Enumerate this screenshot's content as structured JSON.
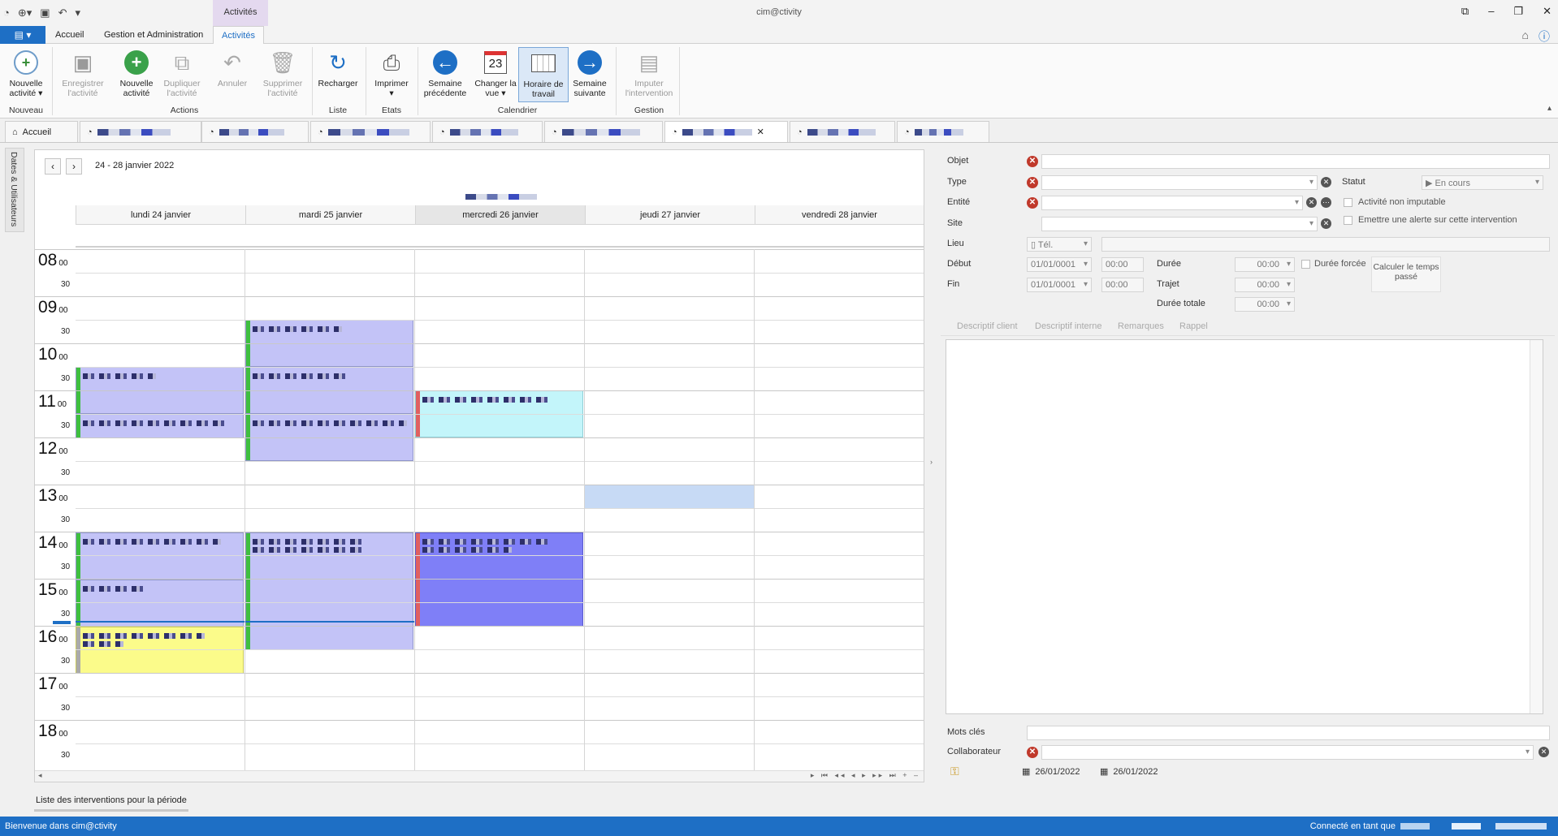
{
  "window": {
    "title": "cim@ctivity",
    "context_tab_header": "Activités"
  },
  "ribbon_tabs": [
    {
      "label": "Accueil"
    },
    {
      "label": "Gestion et Administration"
    },
    {
      "label": "Activités"
    }
  ],
  "ribbon": {
    "buttons": {
      "nouvelle_activite_menu": "Nouvelle activité",
      "enregistrer": "Enregistrer l'activité",
      "nouvelle_activite": "Nouvelle activité",
      "dupliquer": "Dupliquer l'activité",
      "annuler": "Annuler",
      "supprimer": "Supprimer l'activité",
      "recharger": "Recharger",
      "imprimer": "Imprimer",
      "semaine_precedente": "Semaine précédente",
      "changer_vue": "Changer la vue",
      "horaire_travail": "Horaire de travail",
      "semaine_suivante": "Semaine suivante",
      "imputer": "Imputer l'intervention"
    },
    "groups": {
      "nouveau": "Nouveau",
      "actions": "Actions",
      "liste": "Liste",
      "etats": "Etats",
      "calendrier": "Calendrier",
      "gestion": "Gestion"
    },
    "calendar_icon_day": "23"
  },
  "doc_tabs": [
    {
      "label": "Accueil"
    }
  ],
  "side_tab": "Dates & Utilisateurs",
  "calendar": {
    "range": "24 - 28 janvier 2022",
    "days": [
      {
        "label": "lundi 24 janvier"
      },
      {
        "label": "mardi 25 janvier"
      },
      {
        "label": "mercredi 26 janvier"
      },
      {
        "label": "jeudi 27 janvier"
      },
      {
        "label": "vendredi 28 janvier"
      }
    ],
    "hours": [
      "08",
      "09",
      "10",
      "11",
      "12",
      "13",
      "14",
      "15",
      "16",
      "17",
      "18"
    ],
    "minute_label": "00",
    "half_label": "30"
  },
  "list_label": "Liste des interventions pour la période",
  "form": {
    "objet": "Objet",
    "type": "Type",
    "statut": "Statut",
    "statut_value": "En cours",
    "entite": "Entité",
    "activite_non_imputable": "Activité non imputable",
    "site": "Site",
    "emettre_alerte": "Emettre une alerte sur cette intervention",
    "lieu": "Lieu",
    "lieu_value": "Tél.",
    "debut": "Début",
    "fin": "Fin",
    "debut_date": "01/01/0001",
    "fin_date": "01/01/0001",
    "debut_time": "00:00",
    "fin_time": "00:00",
    "duree": "Durée",
    "duree_value": "00:00",
    "duree_forcee": "Durée forcée",
    "trajet": "Trajet",
    "trajet_value": "00:00",
    "duree_totale": "Durée totale",
    "duree_totale_value": "00:00",
    "calculer": "Calculer le temps passé",
    "desc_tabs": [
      "Descriptif client",
      "Descriptif interne",
      "Remarques",
      "Rappel"
    ],
    "mots_cles": "Mots clés",
    "collaborateur": "Collaborateur",
    "created_date": "26/01/2022",
    "modified_date": "26/01/2022"
  },
  "status": {
    "left": "Bienvenue dans cim@ctivity",
    "right": "Connecté en tant que"
  },
  "colors": {
    "accent": "#1e6fc5",
    "appt_purple": "#c3c3f7",
    "appt_cyan": "#c3f5fa",
    "appt_blue": "#7f7ff7",
    "appt_yellow": "#fbfb8a",
    "selected_slot": "#c7daf5"
  }
}
